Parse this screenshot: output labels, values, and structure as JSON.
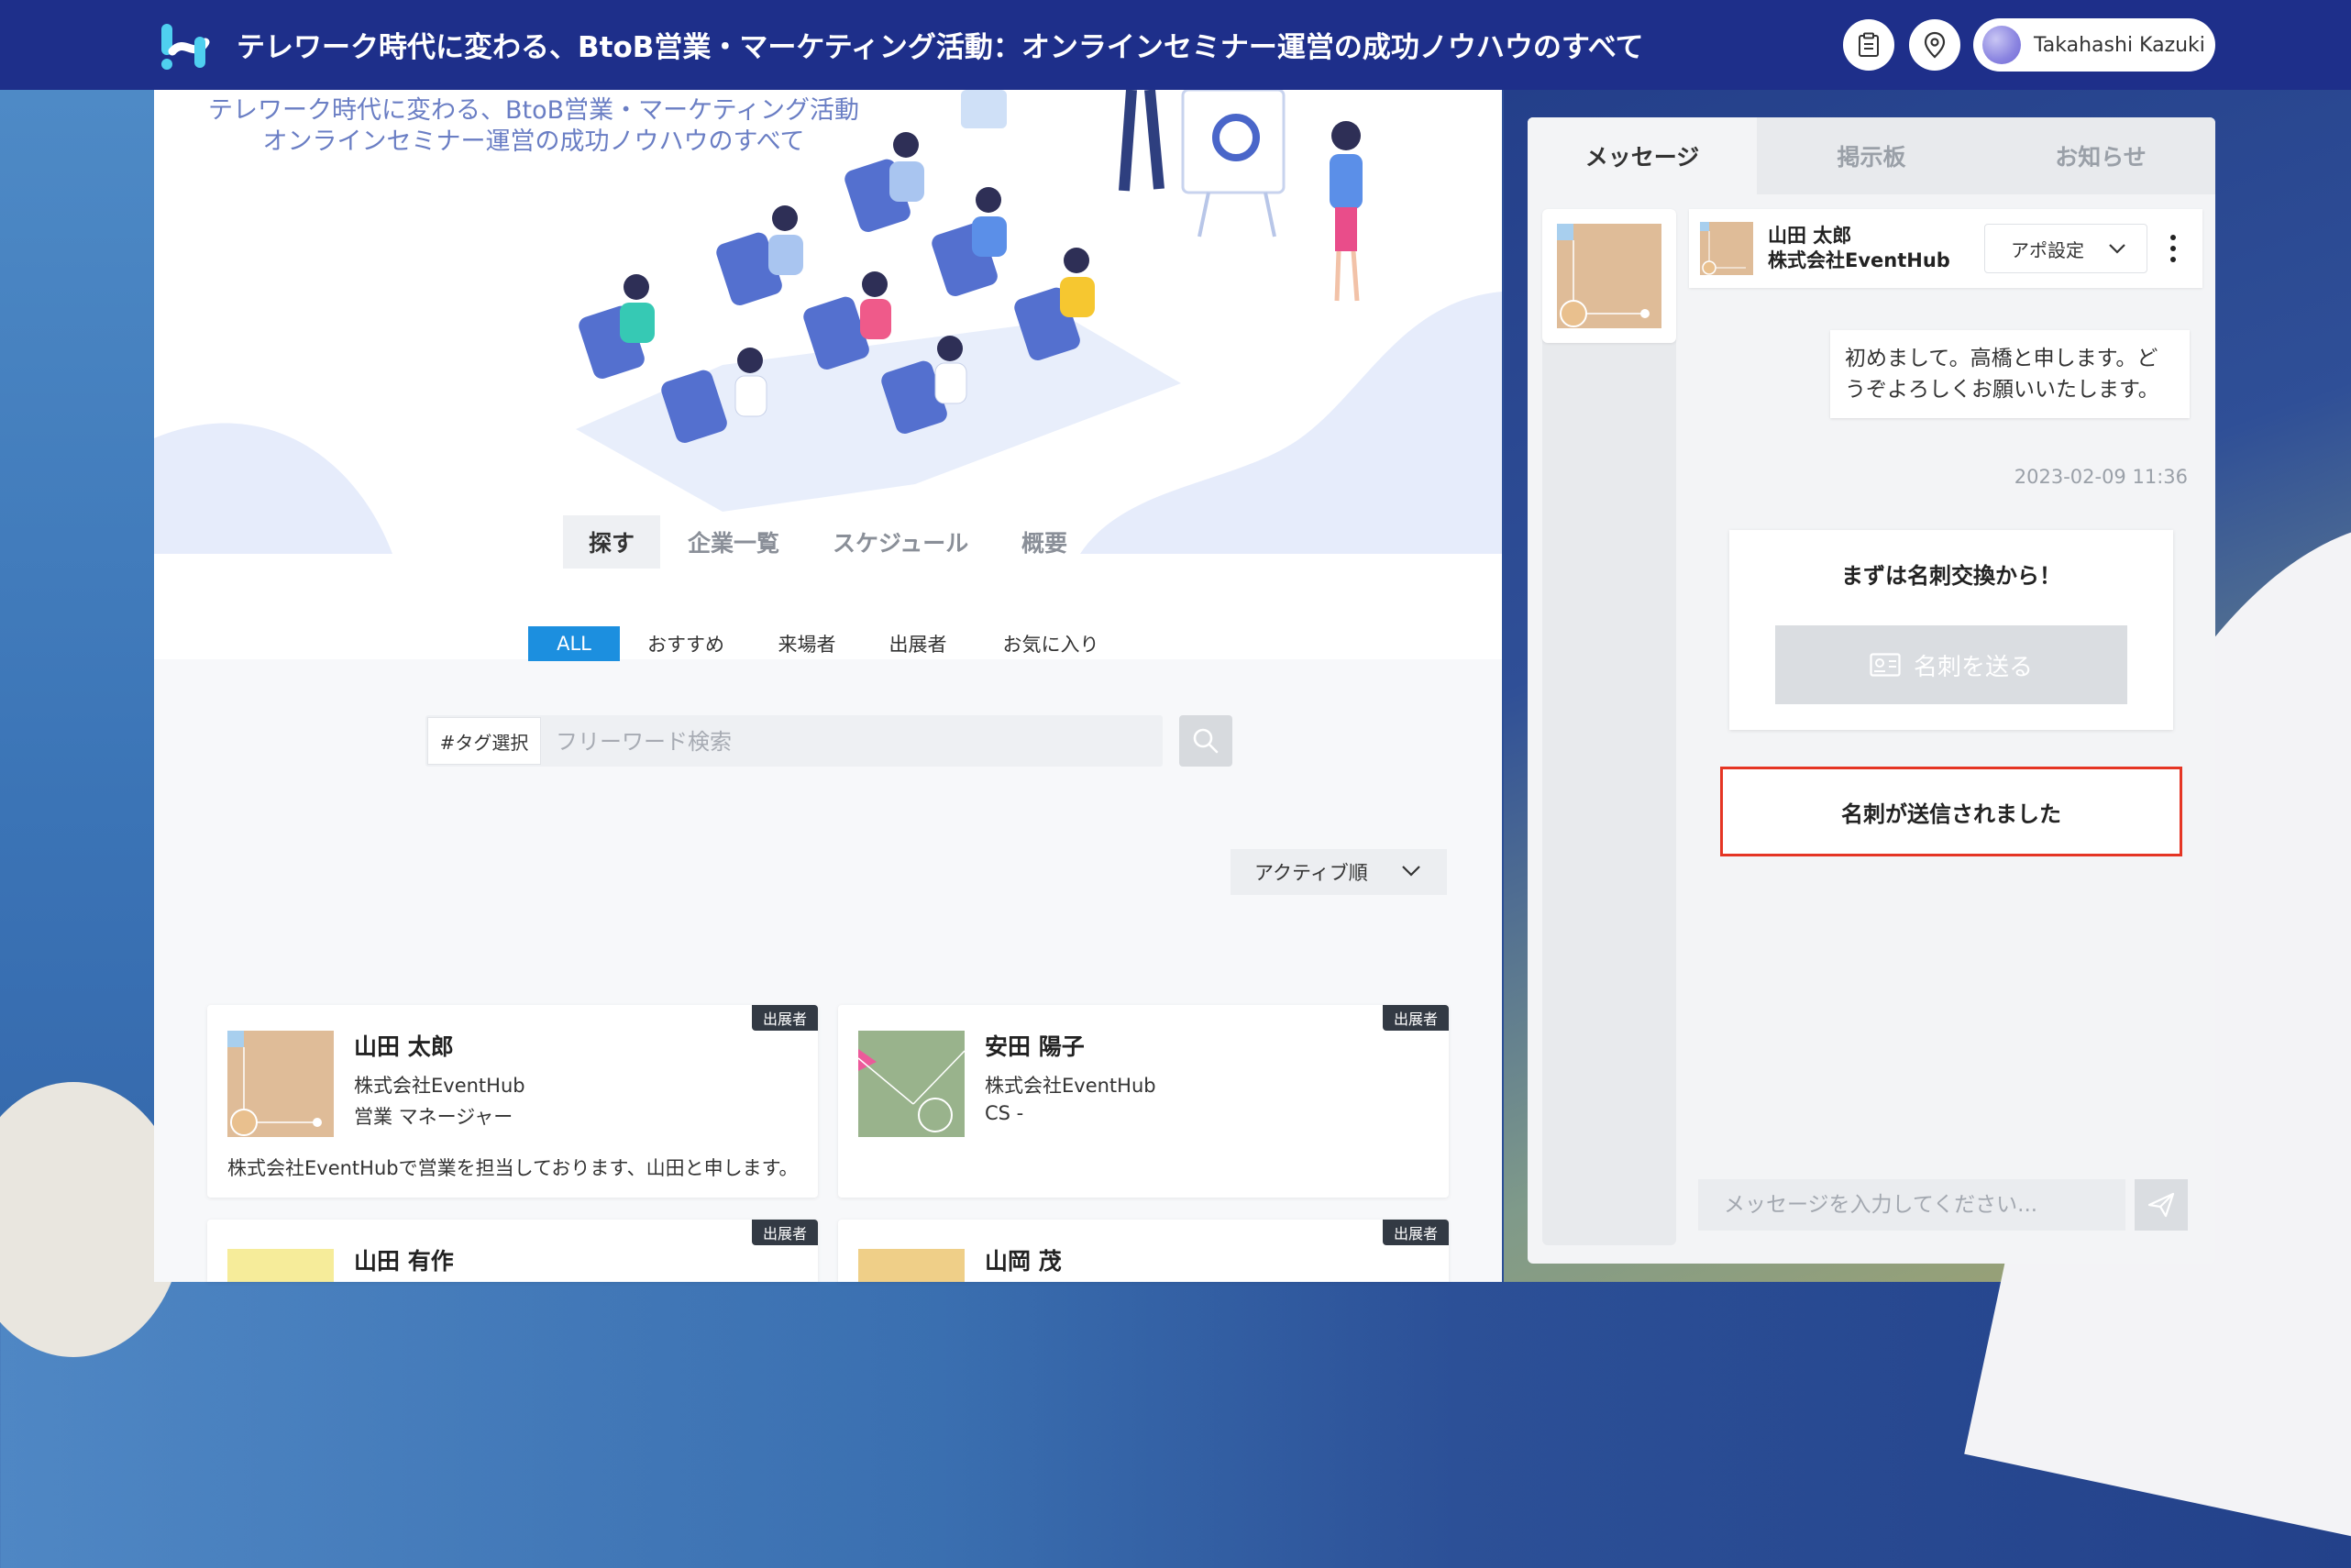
{
  "header": {
    "event_title": "テレワーク時代に変わる、BtoB営業・マーケティング活動：オンラインセミナー運営の成功ノウハウのすべて",
    "user_name": "Takahashi Kazuki",
    "icons": [
      "app-logo",
      "clipboard-icon",
      "location-pin-icon",
      "user-avatar"
    ]
  },
  "hero": {
    "caption_line1": "テレワーク時代に変わる、BtoB営業・マーケティング活動",
    "caption_line2": "オンラインセミナー運営の成功ノウハウのすべて"
  },
  "tabs": [
    "探す",
    "企業一覧",
    "スケジュール",
    "概要"
  ],
  "active_tab": "探す",
  "filters": [
    "ALL",
    "おすすめ",
    "来場者",
    "出展者",
    "お気に入り"
  ],
  "active_filter": "ALL",
  "search": {
    "tag_button": "#タグ選択",
    "placeholder": "フリーワード検索"
  },
  "sort": {
    "label": "アクティブ順"
  },
  "participants": [
    {
      "badge": "出展者",
      "name": "山田 太郎",
      "company": "株式会社EventHub",
      "role": "営業 マネージャー",
      "desc": "株式会社EventHubで営業を担当しております、山田と申します。"
    },
    {
      "badge": "出展者",
      "name": "安田 陽子",
      "company": "株式会社EventHub",
      "role": "CS -",
      "desc": ""
    },
    {
      "badge": "出展者",
      "name": "山田 有作",
      "company": "",
      "role": "",
      "desc": ""
    },
    {
      "badge": "出展者",
      "name": "山岡 茂",
      "company": "",
      "role": "",
      "desc": ""
    }
  ],
  "chat": {
    "tabs": [
      "メッセージ",
      "掲示板",
      "お知らせ"
    ],
    "active_tab": "メッセージ",
    "contact_name": "山田 太郎",
    "contact_company": "株式会社EventHub",
    "appo_label": "アポ設定",
    "message_text": "初めまして。高橋と申します。どうぞよろしくお願いいたします。",
    "message_time": "2023-02-09 11:36",
    "card_prompt": "まずは名刺交換から！",
    "send_card_label": "名刺を送る",
    "card_sent_notice": "名刺が送信されました",
    "input_placeholder": "メッセージを入力してください..."
  }
}
